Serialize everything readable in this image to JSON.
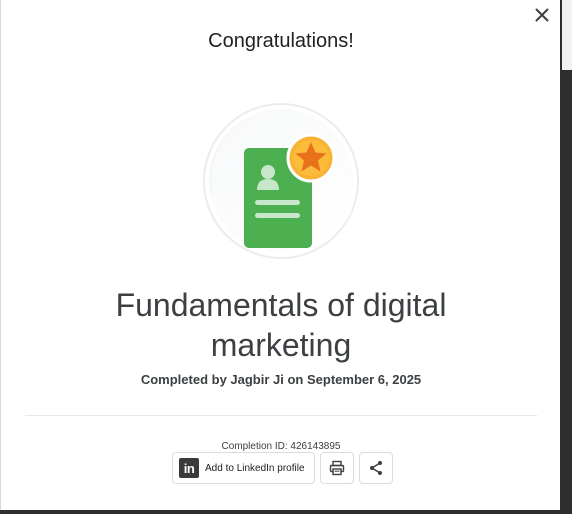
{
  "dialog": {
    "title": "Congratulations!",
    "course_title": "Fundamentals of digital marketing",
    "completed_by": "Completed by Jagbir Ji on September 6, 2025",
    "completion_id": "Completion ID: 426143895",
    "close_icon": "close-icon",
    "badge_icon": "certificate-star-icon"
  },
  "actions": {
    "linkedin_logo": "in",
    "linkedin_label": "Add to LinkedIn profile",
    "print_icon": "print-icon",
    "share_icon": "share-icon"
  },
  "colors": {
    "certificate_green": "#4caf50",
    "star_gold": "#f9b233",
    "star_orange": "#e8711c",
    "text_dark": "#3c4043"
  }
}
